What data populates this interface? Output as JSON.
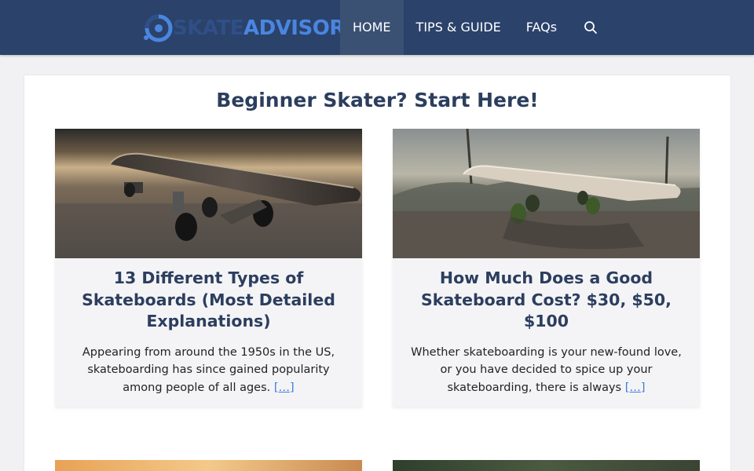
{
  "header": {
    "logo_part1": "SKATE",
    "logo_part2": "ADVISORS",
    "nav": [
      {
        "label": "HOME",
        "active": true
      },
      {
        "label": "TIPS & GUIDE",
        "active": false
      },
      {
        "label": "FAQs",
        "active": false
      }
    ],
    "search_icon": "search-icon"
  },
  "main": {
    "section_title": "Beginner Skater? Start Here!",
    "cards": [
      {
        "title": "13 Different Types of Skateboards (Most Detailed Explanations)",
        "excerpt": "Appearing from around the 1950s in the US, skateboarding has since gained popularity among people of all ages.",
        "read_more": "[…]",
        "image": "skateboard-photo"
      },
      {
        "title": "How Much Does a Good Skateboard Cost? $30, $50, $100",
        "excerpt": "Whether skateboarding is your new-found love, or you have decided to spice up your skateboarding, there is always",
        "read_more": "[…]",
        "image": "skateboard-photo"
      }
    ]
  },
  "colors": {
    "header_bg": "#2b426b",
    "nav_active_bg": "#3a5174",
    "title_color": "#2c3e5e",
    "link_color": "#3d7bd9",
    "logo_dark": "#2f4f86",
    "logo_light": "#4a86e0"
  }
}
